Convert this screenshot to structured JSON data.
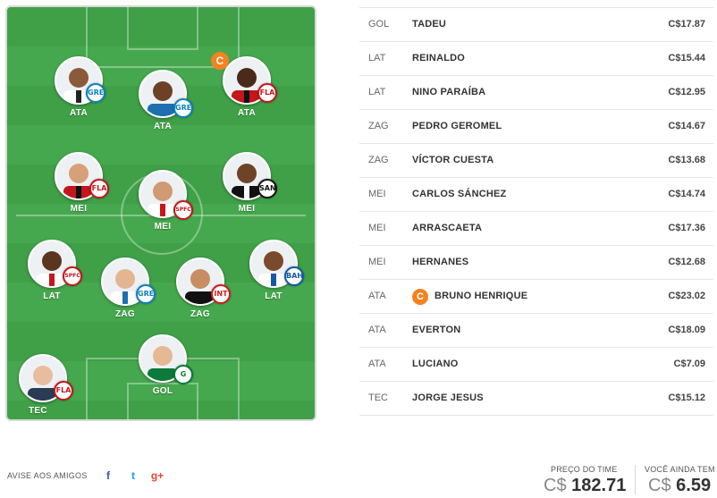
{
  "field": {
    "players": [
      {
        "pos": "ATA",
        "crest": "GRE",
        "crest_fg": "#0d80bf",
        "skin": "#8a5a3b",
        "kit": "#ffffff",
        "stripe": "#222222",
        "captain": false
      },
      {
        "pos": "ATA",
        "crest": "GRE",
        "crest_fg": "#0d80bf",
        "skin": "#6b4226",
        "kit": "#1d6fb0",
        "stripe": "#1d6fb0",
        "captain": false
      },
      {
        "pos": "ATA",
        "crest": "FLA",
        "crest_fg": "#c4161c",
        "skin": "#4a2a1a",
        "kit": "#c4161c",
        "stripe": "#111111",
        "captain": true,
        "captain_label": "C"
      },
      {
        "pos": "MEI",
        "crest": "FLA",
        "crest_fg": "#c4161c",
        "skin": "#d7a07a",
        "kit": "#c4161c",
        "stripe": "#111111",
        "captain": false
      },
      {
        "pos": "MEI",
        "crest": "SPFC",
        "crest_fg": "#c4161c",
        "skin": "#d09a72",
        "kit": "#ffffff",
        "stripe": "#c4161c",
        "captain": false
      },
      {
        "pos": "MEI",
        "crest": "SAN",
        "crest_fg": "#111111",
        "skin": "#6e4428",
        "kit": "#111111",
        "stripe": "#ffffff",
        "captain": false
      },
      {
        "pos": "LAT",
        "crest": "SPFC",
        "crest_fg": "#c4161c",
        "skin": "#5a3520",
        "kit": "#ffffff",
        "stripe": "#c4161c",
        "captain": false
      },
      {
        "pos": "ZAG",
        "crest": "GRE",
        "crest_fg": "#0d80bf",
        "skin": "#e3b592",
        "kit": "#ffffff",
        "stripe": "#1d6fb0",
        "captain": false
      },
      {
        "pos": "ZAG",
        "crest": "INT",
        "crest_fg": "#d21c1c",
        "skin": "#c98d64",
        "kit": "#111111",
        "stripe": "#111111",
        "captain": false
      },
      {
        "pos": "LAT",
        "crest": "BAH",
        "crest_fg": "#1458a6",
        "skin": "#7a4a2c",
        "kit": "#ffffff",
        "stripe": "#1458a6",
        "captain": false
      },
      {
        "pos": "GOL",
        "crest": "G",
        "crest_fg": "#0b7a3a",
        "skin": "#e6b894",
        "kit": "#0b7a3a",
        "stripe": "#0b7a3a",
        "captain": false
      },
      {
        "pos": "TEC",
        "crest": "FLA",
        "crest_fg": "#c4161c",
        "skin": "#e7bda0",
        "kit": "#2b3a55",
        "stripe": "#2b3a55",
        "captain": false
      }
    ]
  },
  "lineup": [
    {
      "pos": "GOL",
      "name": "TADEU",
      "price": "C$17.87",
      "captain": false
    },
    {
      "pos": "LAT",
      "name": "REINALDO",
      "price": "C$15.44",
      "captain": false
    },
    {
      "pos": "LAT",
      "name": "NINO PARAÍBA",
      "price": "C$12.95",
      "captain": false
    },
    {
      "pos": "ZAG",
      "name": "PEDRO GEROMEL",
      "price": "C$14.67",
      "captain": false
    },
    {
      "pos": "ZAG",
      "name": "VÍCTOR CUESTA",
      "price": "C$13.68",
      "captain": false
    },
    {
      "pos": "MEI",
      "name": "CARLOS SÁNCHEZ",
      "price": "C$14.74",
      "captain": false
    },
    {
      "pos": "MEI",
      "name": "ARRASCAETA",
      "price": "C$17.36",
      "captain": false
    },
    {
      "pos": "MEI",
      "name": "HERNANES",
      "price": "C$12.68",
      "captain": false
    },
    {
      "pos": "ATA",
      "name": "BRUNO HENRIQUE",
      "price": "C$23.02",
      "captain": true,
      "captain_label": "C"
    },
    {
      "pos": "ATA",
      "name": "EVERTON",
      "price": "C$18.09",
      "captain": false
    },
    {
      "pos": "ATA",
      "name": "LUCIANO",
      "price": "C$7.09",
      "captain": false
    },
    {
      "pos": "TEC",
      "name": "JORGE JESUS",
      "price": "C$15.12",
      "captain": false
    }
  ],
  "footer": {
    "share_label": "AVISE AOS AMIGOS",
    "social": [
      {
        "icon": "facebook-icon",
        "glyph": "f",
        "color": "#3b5998"
      },
      {
        "icon": "twitter-icon",
        "glyph": "t",
        "color": "#1da1f2"
      },
      {
        "icon": "google-plus-icon",
        "glyph": "g+",
        "color": "#dd4b39"
      }
    ],
    "team_price_label": "PREÇO DO TIME",
    "team_price_currency": "C$",
    "team_price_value": "182.71",
    "balance_label": "VOCÊ AINDA TEM",
    "balance_currency": "C$",
    "balance_value": "6.59"
  },
  "colors": {
    "captain": "#f58220",
    "field": "#3fa048"
  }
}
